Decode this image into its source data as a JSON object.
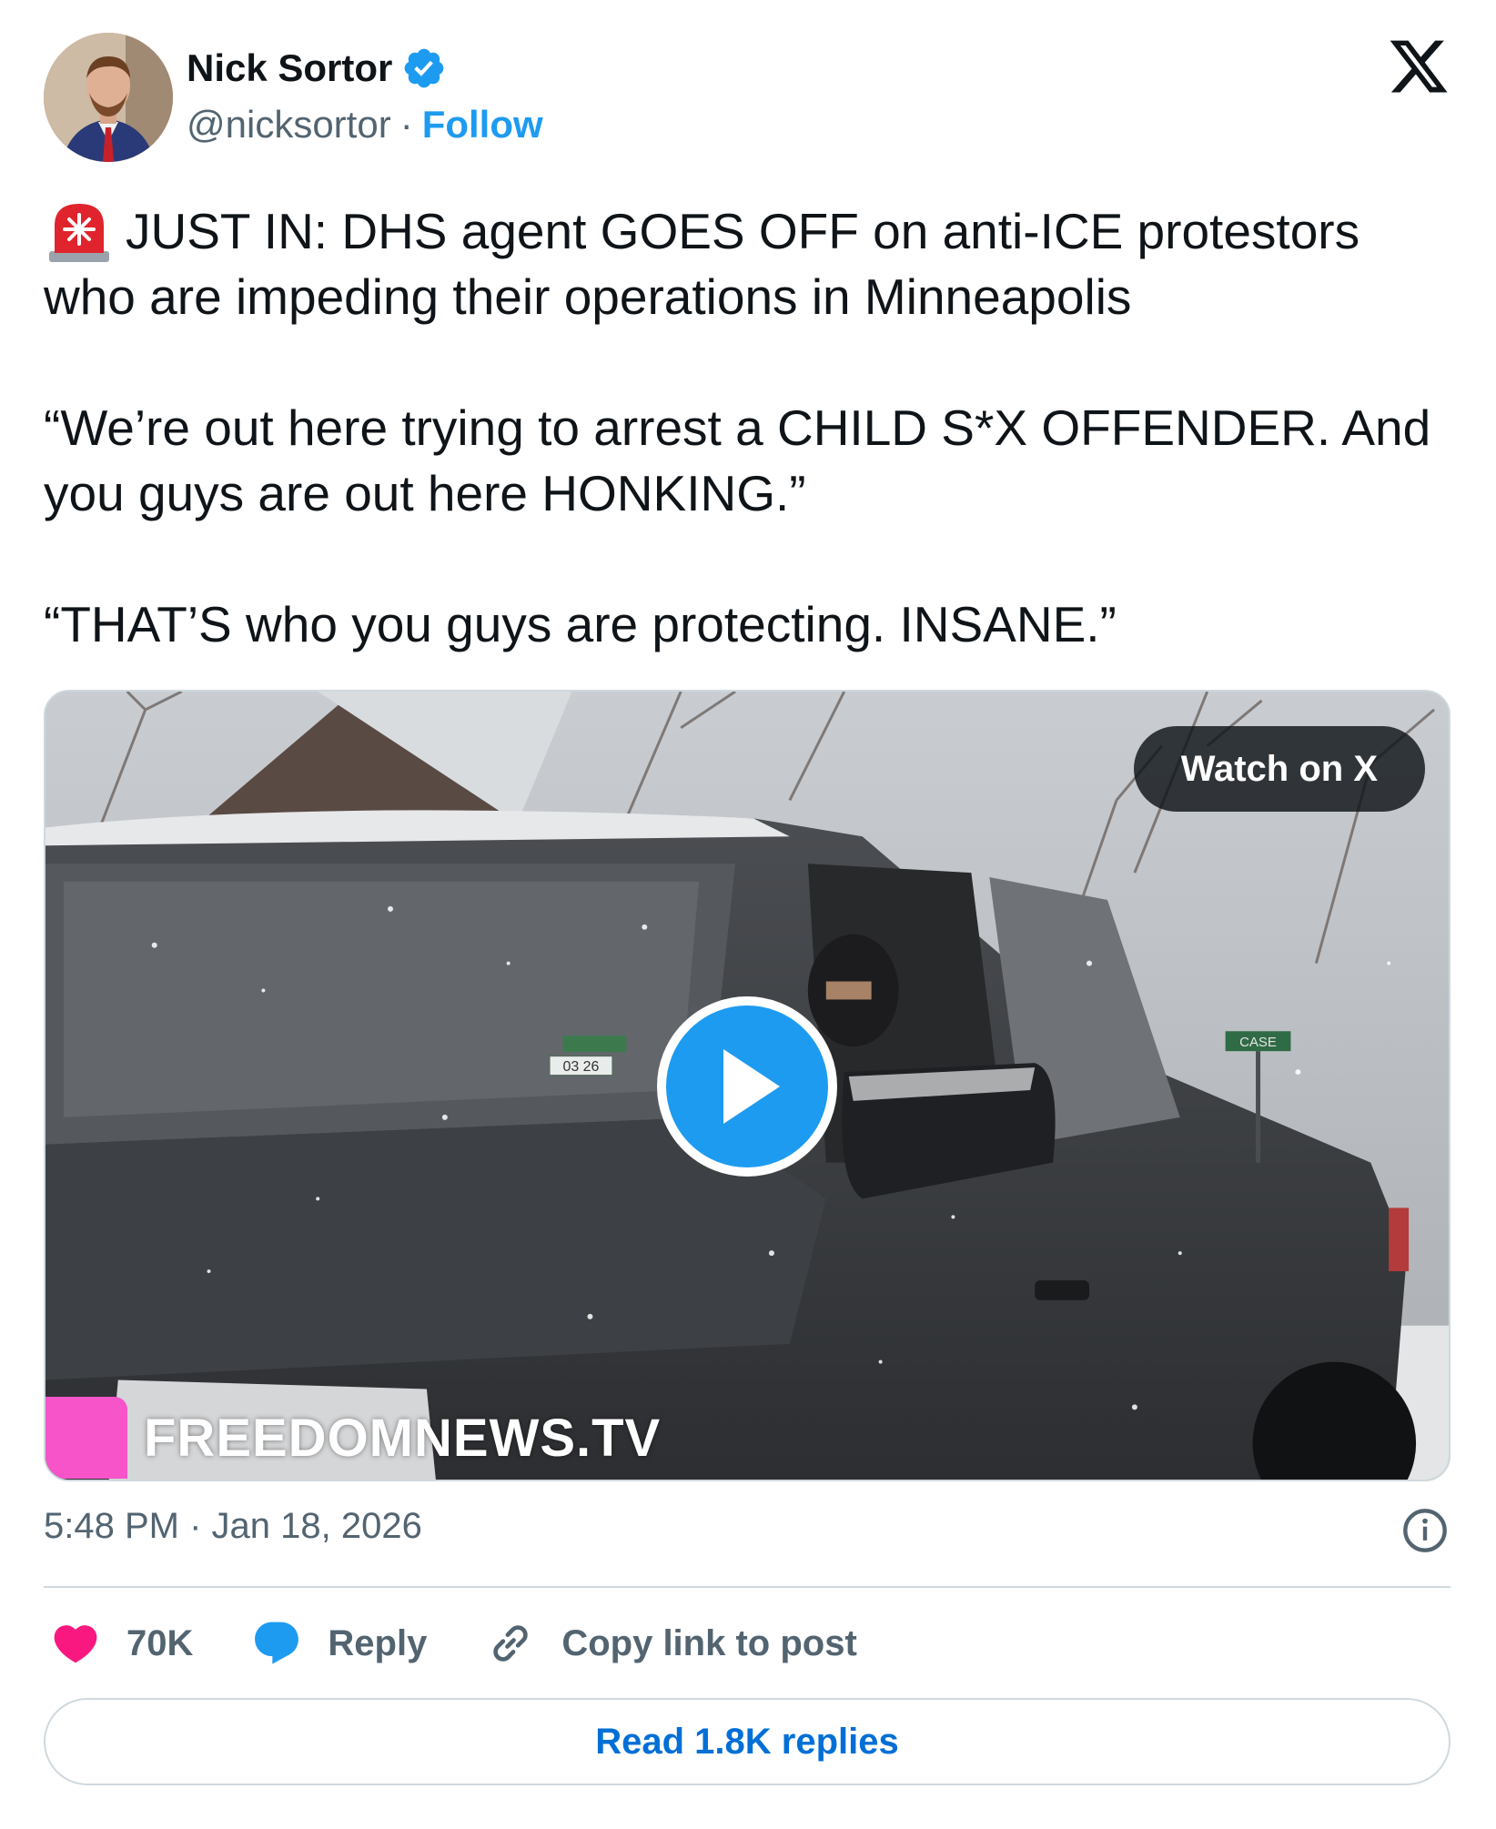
{
  "author": {
    "name": "Nick Sortor",
    "handle": "@nicksortor",
    "separator": "·",
    "follow_label": "Follow",
    "verified": true
  },
  "tweet": {
    "text": "JUST IN: DHS agent GOES OFF on anti-ICE protestors who are impeding their operations in Minneapolis\n\n“We’re out here trying to arrest a CHILD S*X OFFENDER. And you guys are out here HONKING.”\n\n“THAT’S who you guys are protecting. INSANE.”",
    "leading_emoji": "rotating-light-icon"
  },
  "media": {
    "watch_label": "Watch on X",
    "watermark": "FREEDOMNEWS.TV",
    "sticker_text": "03 26",
    "sign_text": "CASE"
  },
  "footer": {
    "timestamp": "5:48 PM · Jan 18, 2026",
    "likes": "70K",
    "reply_label": "Reply",
    "copy_label": "Copy link to post",
    "read_replies_label": "Read 1.8K replies"
  },
  "colors": {
    "accent": "#1d9bf0",
    "like": "#f91880",
    "link_dark": "#006fd6",
    "muted": "#536471"
  }
}
